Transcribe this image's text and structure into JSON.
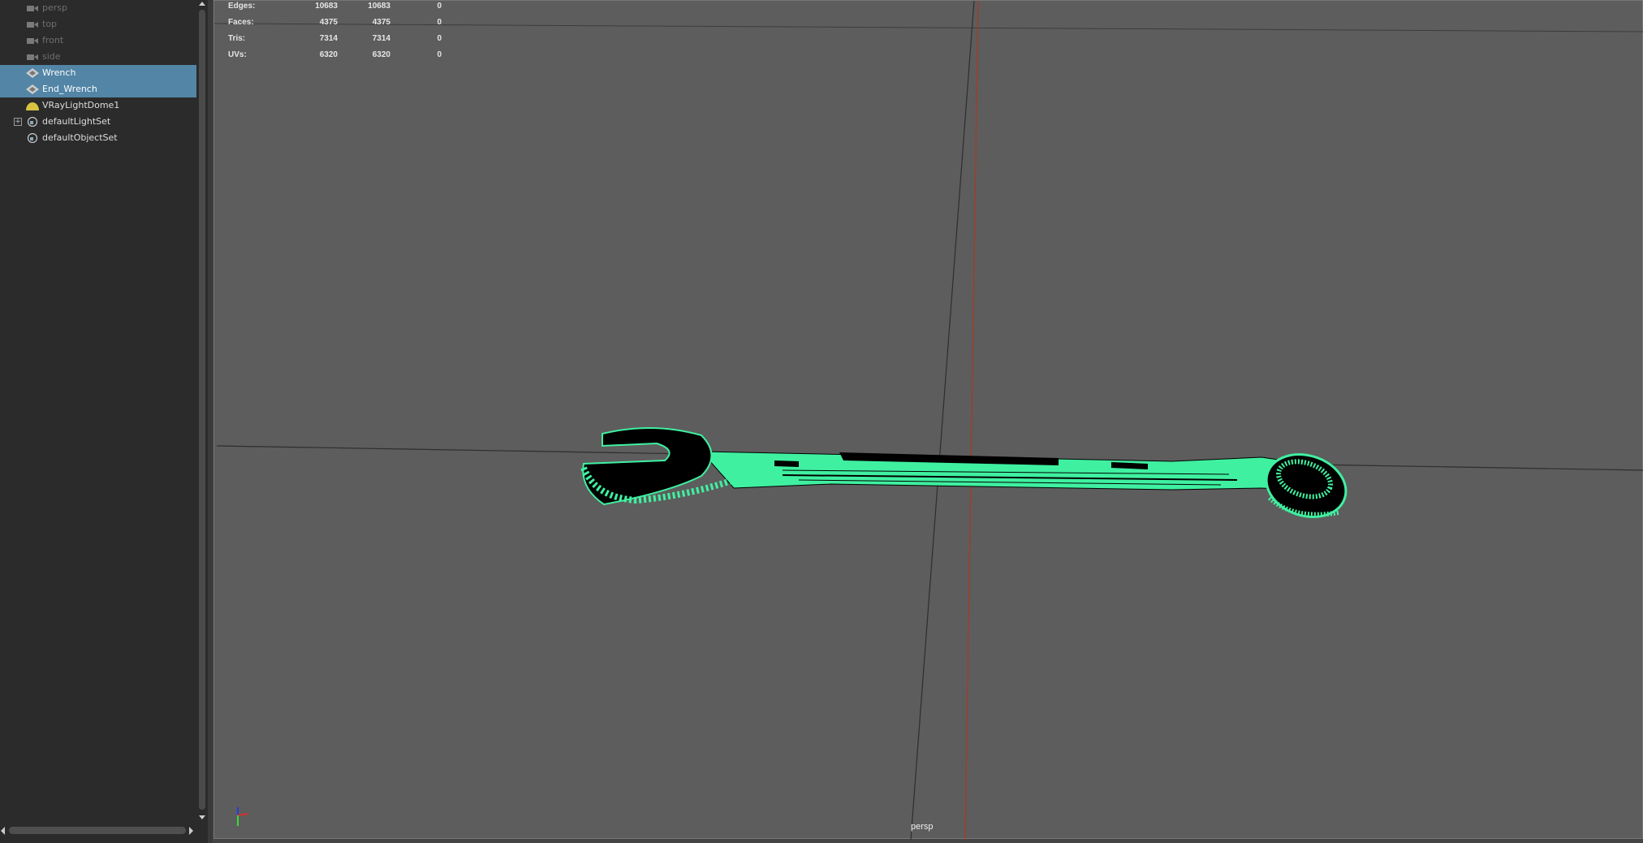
{
  "outliner": {
    "items": [
      {
        "label": "persp",
        "icon": "camera-icon",
        "state": "dim"
      },
      {
        "label": "top",
        "icon": "camera-icon",
        "state": "dim"
      },
      {
        "label": "front",
        "icon": "camera-icon",
        "state": "dim"
      },
      {
        "label": "side",
        "icon": "camera-icon",
        "state": "dim"
      },
      {
        "label": "Wrench",
        "icon": "mesh-icon",
        "state": "selected"
      },
      {
        "label": "End_Wrench",
        "icon": "mesh-icon",
        "state": "selected"
      },
      {
        "label": "VRayLightDome1",
        "icon": "dome-light-icon",
        "state": "normal"
      },
      {
        "label": "defaultLightSet",
        "icon": "set-icon",
        "state": "normal",
        "expand": "+"
      },
      {
        "label": "defaultObjectSet",
        "icon": "set-icon",
        "state": "normal"
      }
    ]
  },
  "hud": {
    "rows": [
      {
        "label": "Edges:",
        "v1": "10683",
        "v2": "10683",
        "v3": "0"
      },
      {
        "label": "Faces:",
        "v1": "4375",
        "v2": "4375",
        "v3": "0"
      },
      {
        "label": "Tris:",
        "v1": "7314",
        "v2": "7314",
        "v3": "0"
      },
      {
        "label": "UVs:",
        "v1": "6320",
        "v2": "6320",
        "v3": "0"
      }
    ]
  },
  "viewport": {
    "camera_label": "persp",
    "wireframe_color": "#3ff0a0",
    "selection_color": "#5285a6"
  }
}
